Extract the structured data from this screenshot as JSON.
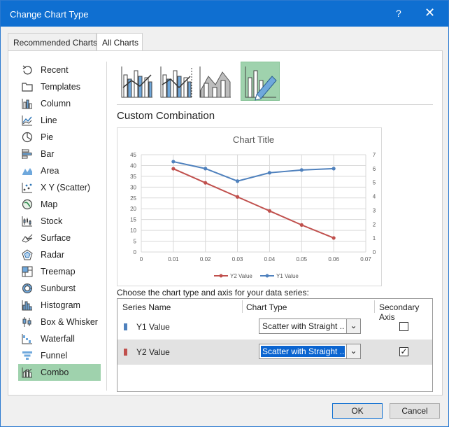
{
  "window": {
    "title": "Change Chart Type",
    "help_glyph": "?",
    "close_glyph": "✕"
  },
  "tabs": [
    {
      "label": "Recommended Charts",
      "active": false
    },
    {
      "label": "All Charts",
      "active": true
    }
  ],
  "sidebar": {
    "items": [
      {
        "label": "Recent",
        "icon": "recent-icon"
      },
      {
        "label": "Templates",
        "icon": "templates-icon"
      },
      {
        "label": "Column",
        "icon": "column-chart-icon"
      },
      {
        "label": "Line",
        "icon": "line-chart-icon"
      },
      {
        "label": "Pie",
        "icon": "pie-chart-icon"
      },
      {
        "label": "Bar",
        "icon": "bar-chart-icon"
      },
      {
        "label": "Area",
        "icon": "area-chart-icon"
      },
      {
        "label": "X Y (Scatter)",
        "icon": "scatter-chart-icon"
      },
      {
        "label": "Map",
        "icon": "map-chart-icon"
      },
      {
        "label": "Stock",
        "icon": "stock-chart-icon"
      },
      {
        "label": "Surface",
        "icon": "surface-chart-icon"
      },
      {
        "label": "Radar",
        "icon": "radar-chart-icon"
      },
      {
        "label": "Treemap",
        "icon": "treemap-chart-icon"
      },
      {
        "label": "Sunburst",
        "icon": "sunburst-chart-icon"
      },
      {
        "label": "Histogram",
        "icon": "histogram-chart-icon"
      },
      {
        "label": "Box & Whisker",
        "icon": "box-whisker-chart-icon"
      },
      {
        "label": "Waterfall",
        "icon": "waterfall-chart-icon"
      },
      {
        "label": "Funnel",
        "icon": "funnel-chart-icon"
      },
      {
        "label": "Combo",
        "icon": "combo-chart-icon",
        "active": true
      }
    ]
  },
  "subtypes": [
    {
      "icon": "clustered-column-line-icon"
    },
    {
      "icon": "clustered-column-line-secondary-icon"
    },
    {
      "icon": "stacked-area-column-icon"
    },
    {
      "icon": "custom-combination-icon",
      "active": true
    }
  ],
  "section_title": "Custom Combination",
  "chart_data": {
    "type": "scatter",
    "title": "Chart Title",
    "x": [
      0.01,
      0.02,
      0.03,
      0.04,
      0.05,
      0.06
    ],
    "xlim": [
      0,
      0.07
    ],
    "x_ticks": [
      "0",
      "0.01",
      "0.02",
      "0.03",
      "0.04",
      "0.05",
      "0.06",
      "0.07"
    ],
    "ylim": [
      0,
      45
    ],
    "y_ticks": [
      "0",
      "5",
      "10",
      "15",
      "20",
      "25",
      "30",
      "35",
      "40",
      "45"
    ],
    "y2lim": [
      0,
      7
    ],
    "y2_ticks": [
      "0",
      "1",
      "2",
      "3",
      "4",
      "5",
      "6",
      "7"
    ],
    "grid": true,
    "legend": "bottom",
    "series": [
      {
        "name": "Y2 Value",
        "axis": "primary",
        "color": "#c0504d",
        "values": [
          38.5,
          32,
          25.5,
          19,
          12.5,
          6.5
        ]
      },
      {
        "name": "Y1 Value",
        "axis": "secondary",
        "color": "#4f81bd",
        "values": [
          6.5,
          6.0,
          5.1,
          5.7,
          5.9,
          6.0
        ]
      }
    ]
  },
  "choose_label": "Choose the chart type and axis for your data series:",
  "series_table": {
    "headers": {
      "name": "Series Name",
      "type": "Chart Type",
      "secondary": "Secondary Axis"
    },
    "rows": [
      {
        "name": "Y1 Value",
        "color": "#4f81bd",
        "chart_type": "Scatter with Straight ...",
        "secondary": false,
        "selected": false
      },
      {
        "name": "Y2 Value",
        "color": "#c0504d",
        "chart_type": "Scatter with Straight ...",
        "secondary": true,
        "selected": true
      }
    ],
    "dropdown_glyph": "⌄",
    "check_glyph": "✓"
  },
  "buttons": {
    "ok": "OK",
    "cancel": "Cancel"
  }
}
